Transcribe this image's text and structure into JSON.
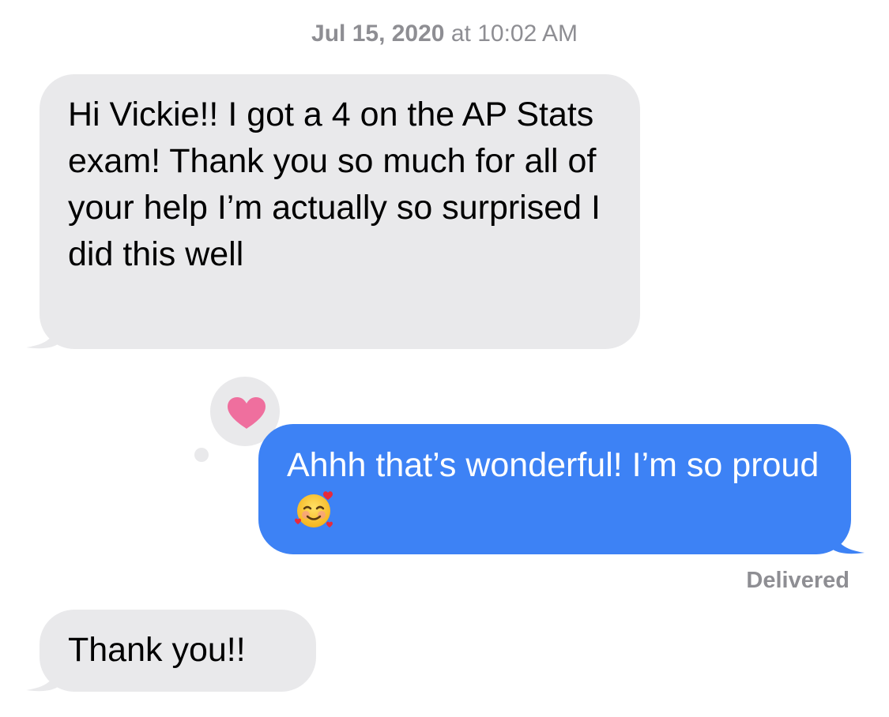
{
  "header": {
    "date": "Jul 15, 2020",
    "time_prefix": " at ",
    "time": "10:02 AM"
  },
  "messages": [
    {
      "direction": "received",
      "text": "Hi Vickie!! I got a 4 on the AP Stats exam! Thank you so much for all of your help I’m actually so surprised I did this well"
    },
    {
      "direction": "sent",
      "text": "Ahhh that’s wonderful! I’m so proud",
      "emoji": "smiling-face-with-hearts",
      "reaction": "heart",
      "status": "Delivered"
    },
    {
      "direction": "received",
      "text": "Thank you!!"
    }
  ],
  "colors": {
    "received_bubble": "#e9e9eb",
    "sent_bubble": "#3d82f5",
    "meta_text": "#8e8e93",
    "reaction_heart": "#ef6f9e"
  }
}
